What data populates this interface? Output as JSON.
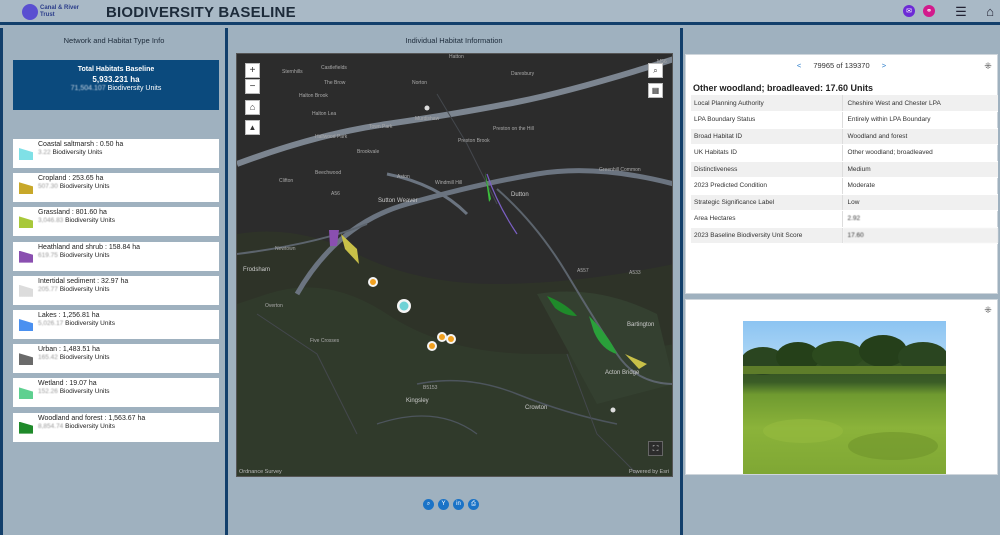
{
  "header": {
    "logo_text": "Canal & River Trust",
    "title": "BIODIVERSITY BASELINE"
  },
  "left_panel": {
    "title": "Network and Habitat Type Info",
    "total": {
      "label": "Total Habitats Baseline",
      "value": "5,933.231  ha",
      "units_value": "71,504.107",
      "units_label": "Biodiversity Units"
    },
    "habitats": [
      {
        "name": "Coastal saltmarsh",
        "ha": "0.50",
        "units": "3.22",
        "color": "#7fe0e6"
      },
      {
        "name": "Cropland",
        "ha": "253.65",
        "units": "507.30",
        "color": "#c8a82a"
      },
      {
        "name": "Grassland",
        "ha": "801.60",
        "units": "3,046.83",
        "color": "#a8c83a"
      },
      {
        "name": "Heathland and shrub",
        "ha": "158.84",
        "units": "619.75",
        "color": "#8a4fb0"
      },
      {
        "name": "Intertidal sediment",
        "ha": "32.97",
        "units": "205.77",
        "color": "#dcdcdc"
      },
      {
        "name": "Lakes",
        "ha": "1,256.81",
        "units": "5,026.17",
        "color": "#4a90f0"
      },
      {
        "name": "Urban",
        "ha": "1,483.51",
        "units": "165.42",
        "color": "#6a6a6a"
      },
      {
        "name": "Wetland",
        "ha": "19.07",
        "units": "152.26",
        "color": "#5ed090"
      },
      {
        "name": "Woodland and forest",
        "ha": "1,563.67",
        "units": "8,854.74",
        "color": "#1f8a2a"
      }
    ],
    "ha_suffix": "ha",
    "units_suffix": "Biodiversity Units"
  },
  "map_panel": {
    "title": "Individual Habitat Information",
    "labels": [
      "Hatton",
      "Sternhills",
      "Castlefields",
      "The Brow",
      "Norton",
      "Daresbury",
      "Halton Brook",
      "Halton Lea",
      "Murdishaw",
      "Town Park",
      "Preston on the Hill",
      "Hallwood Park",
      "Preston Brook",
      "Brookvale",
      "Greenhill Common",
      "Clifton",
      "Beechwood",
      "Windmill Hill",
      "Aston",
      "Dutton",
      "Sutton Weaver",
      "Frodsham",
      "Newtown",
      "Overton",
      "Five Crosses",
      "Bartington",
      "Acton Bridge",
      "Kingsley",
      "Crowton",
      "A533",
      "A56",
      "B5153",
      "A557",
      "M56"
    ],
    "attribution_left": "Ordnance Survey",
    "attribution_right": "Powered by Esri",
    "tools": [
      "search",
      "layers",
      "add",
      "identify"
    ]
  },
  "info_panel": {
    "pager": "79965 of 139370",
    "heading": "Other woodland; broadleaved: 17.60 Units",
    "rows": [
      {
        "label": "Local Planning Authority",
        "value": "Cheshire West and Chester LPA"
      },
      {
        "label": "LPA Boundary Status",
        "value": "Entirely within LPA Boundary"
      },
      {
        "label": "Broad Habitat ID",
        "value": "Woodland and forest"
      },
      {
        "label": "UK Habitats ID",
        "value": "Other woodland; broadleaved"
      },
      {
        "label": "Distinctiveness",
        "value": "Medium"
      },
      {
        "label": "2023 Predicted Condition",
        "value": "Moderate"
      },
      {
        "label": "Strategic Significance Label",
        "value": "Low"
      },
      {
        "label": "Area Hectares",
        "value": "2.92"
      },
      {
        "label": "2023 Baseline Biodiversity Unit Score",
        "value": "17.60"
      }
    ]
  },
  "colors": {
    "header_border": "#123f6b",
    "total_box": "#0b4a7d",
    "accent": "#1a73c7",
    "header_btn_1": "#6c2ad6",
    "header_btn_2": "#d21a8c"
  }
}
